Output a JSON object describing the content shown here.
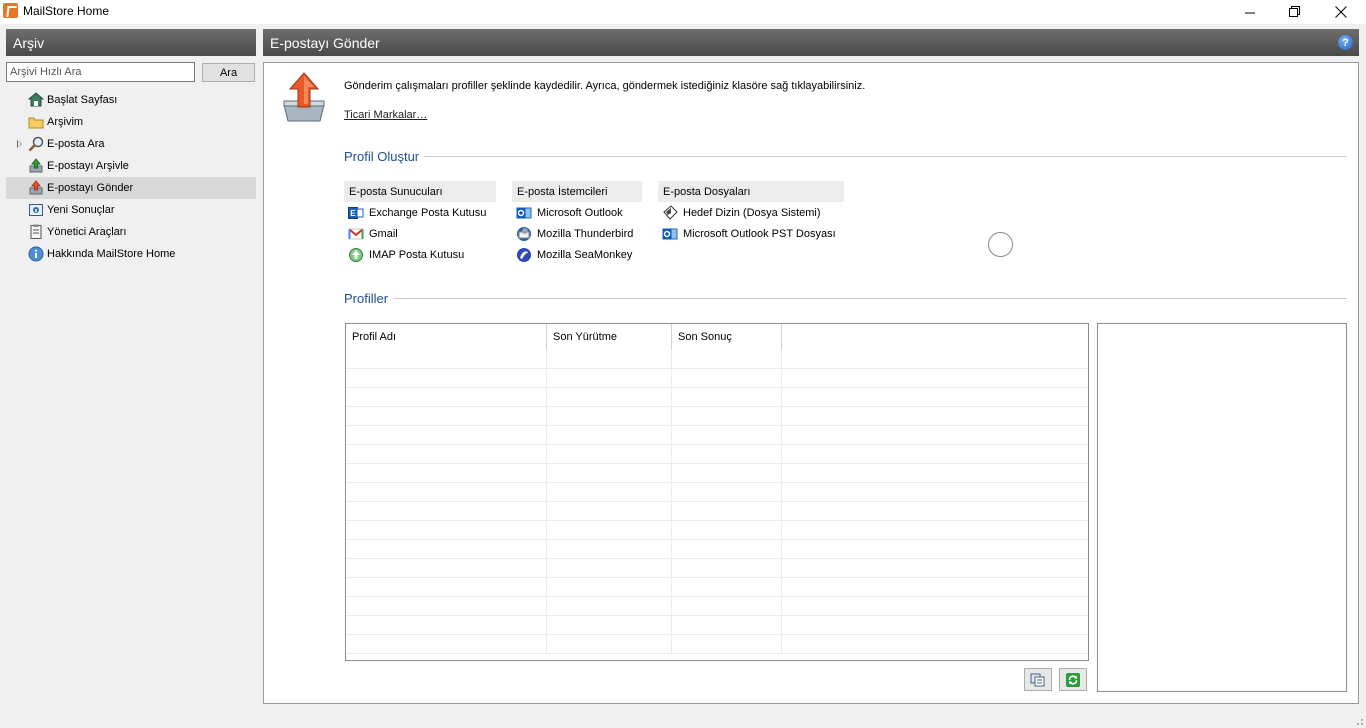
{
  "window": {
    "title": "MailStore Home",
    "controls": {
      "minimize": "minimize-icon",
      "maximize": "restore-icon",
      "close": "close-icon"
    }
  },
  "left_panel": {
    "header": "Arşiv",
    "search": {
      "placeholder": "Arşivi Hızlı Ara",
      "value": "",
      "button_label": "Ara"
    },
    "nav_items": [
      {
        "label": "Başlat Sayfası",
        "icon": "home-icon",
        "active": false,
        "expandable": false
      },
      {
        "label": "Arşivim",
        "icon": "folder-icon",
        "active": false,
        "expandable": false
      },
      {
        "label": "E-posta Ara",
        "icon": "magnifier-icon",
        "active": false,
        "expandable": true
      },
      {
        "label": "E-postayı Arşivle",
        "icon": "archive-email-icon",
        "active": false,
        "expandable": false
      },
      {
        "label": "E-postayı Gönder",
        "icon": "export-email-icon",
        "active": true,
        "expandable": false
      },
      {
        "label": "Yeni Sonuçlar",
        "icon": "results-icon",
        "active": false,
        "expandable": false
      },
      {
        "label": "Yönetici Araçları",
        "icon": "admin-tools-icon",
        "active": false,
        "expandable": false
      },
      {
        "label": "Hakkında MailStore Home",
        "icon": "info-icon",
        "active": false,
        "expandable": false
      }
    ]
  },
  "main": {
    "header": "E-postayı Gönder",
    "help_icon": "help-icon",
    "intro_text": "Gönderim çalışmaları profiller şeklinde kaydedilir. Ayrıca, göndermek istediğiniz klasöre sağ tıklayabilirsiniz.",
    "trademarks_link": "Ticari Markalar…",
    "create_profile": {
      "title": "Profil Oluştur",
      "columns": [
        {
          "header": "E-posta Sunucuları",
          "items": [
            {
              "label": "Exchange Posta Kutusu",
              "icon": "exchange-icon"
            },
            {
              "label": "Gmail",
              "icon": "gmail-icon"
            },
            {
              "label": "IMAP Posta Kutusu",
              "icon": "imap-icon"
            }
          ]
        },
        {
          "header": "E-posta İstemcileri",
          "items": [
            {
              "label": "Microsoft Outlook",
              "icon": "outlook-icon"
            },
            {
              "label": "Mozilla Thunderbird",
              "icon": "thunderbird-icon"
            },
            {
              "label": "Mozilla SeaMonkey",
              "icon": "seamonkey-icon"
            }
          ]
        },
        {
          "header": "E-posta Dosyaları",
          "items": [
            {
              "label": "Hedef Dizin (Dosya Sistemi)",
              "icon": "directory-icon"
            },
            {
              "label": "Microsoft Outlook PST Dosyası",
              "icon": "outlook-pst-icon"
            }
          ]
        }
      ]
    },
    "profiles": {
      "title": "Profiller",
      "columns": [
        "Profil Adı",
        "Son Yürütme",
        "Son Sonuç"
      ],
      "rows": [],
      "buttons": [
        {
          "name": "copy-profile-button",
          "icon": "copy-icon"
        },
        {
          "name": "refresh-button",
          "icon": "refresh-icon"
        }
      ]
    }
  },
  "colors": {
    "header_bg": "#5a5a5a",
    "section_title": "#1f4f8f",
    "active_nav": "#d8d8d8"
  }
}
